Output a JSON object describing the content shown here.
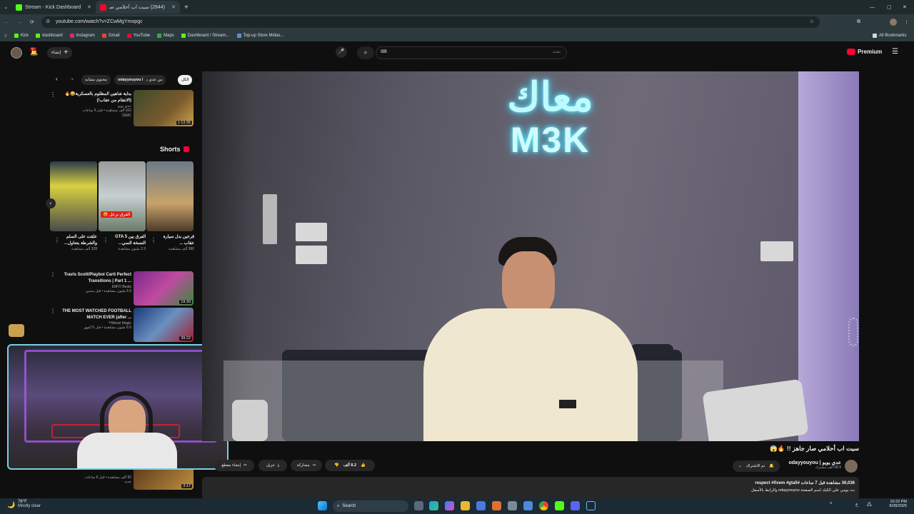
{
  "browser": {
    "tabs": [
      {
        "label": "Stream - Kick Dashboard",
        "fav_color": "#53fc18"
      },
      {
        "label": "(2844) سيت اب أحلامي صار",
        "fav_color": "#ff0033"
      }
    ],
    "url": "youtube.com/watch?v=ZCwMgYmopgc",
    "bookmarks": [
      "Kick",
      "dashboard",
      "instagram",
      "Gmail",
      "YouTube",
      "Maps",
      "Dashboard / Stream...",
      "Top-up Store Midas..."
    ],
    "all_bookmarks": "All Bookmarks"
  },
  "youtube": {
    "premium": "Premium",
    "search_placeholder": "بحث",
    "create_label": "إنشاء",
    "notif_count": "9+",
    "chips": [
      "الكل",
      "من عدي يويو ا",
      "odayyouyou ا",
      "محتوى مشابه"
    ],
    "top_video": {
      "title": "بداية شاهين المظلوم بالعسكرية😂🔥 (الانتقام من عقاب!)",
      "channel": "عدي يويو",
      "meta": "102 ألف مشاهدة • قبل 6 ساعات",
      "badge": "جديد",
      "duration": "1:13:35"
    },
    "shorts_title": "Shorts",
    "shorts": [
      {
        "title": "قرعين بدل سيارة عقاب ...",
        "views": "380 ألف مشاهدة"
      },
      {
        "title": "الفرق بين GTA 5 النسخة السي...",
        "views": "2.3 مليون مشاهدة",
        "overlay": "الفرق بزعل 😡"
      },
      {
        "title": "علقت على السلم والشرطة بتحاول...",
        "views": "328 ألف مشاهدة"
      }
    ],
    "related": [
      {
        "title": "Travis Scott/Playboi Carti Perfect Transitions | Part 1 ...",
        "channel": "E8FO Beats",
        "meta": "6.9 مليون مشاهدة • قبل سنتين",
        "duration": "19:30"
      },
      {
        "title": "THE MOST WATCHED FOOTBALL MATCH EVER (after ...",
        "channel": "Messi Magic™",
        "meta": "6.5 مليون مشاهدة • قبل 5 أشهر",
        "duration": "39:22"
      },
      {
        "title": "",
        "channel": "",
        "meta": "92 ألف مشاهدة • قبل 6 ساعات",
        "duration": "3:17",
        "badge": "جديد"
      }
    ],
    "video_title": "سيت اب أحلامي صار جاهز !! 🔥😱",
    "channel_name": "عدي يويو | odayyouyou",
    "subscribers": "58.9 ألف مشترك",
    "subscribed": "تم الاشتراك",
    "likes": "8.2 ألف",
    "share": "مشاركة",
    "download": "تنزيل",
    "clip": "إنشاء مقطع",
    "views_line": "36,036 مشاهدة قبل 7 ساعات #respect #fivem #gta5",
    "desc_line": "بث يومي على الكيك اسم الصفحة odayyouyou والرابط بالأسفل",
    "sign_text": "معاك",
    "sign_sub": "M3K"
  },
  "taskbar": {
    "weather_temp": "76°F",
    "weather_text": "Mostly clear",
    "search": "Search",
    "time": "10:22 PM",
    "date": "8/28/2025",
    "lang": "ع"
  },
  "colors": {
    "accent": "#ff0033",
    "kick": "#53fc18",
    "sign": "#6ff3ff"
  }
}
